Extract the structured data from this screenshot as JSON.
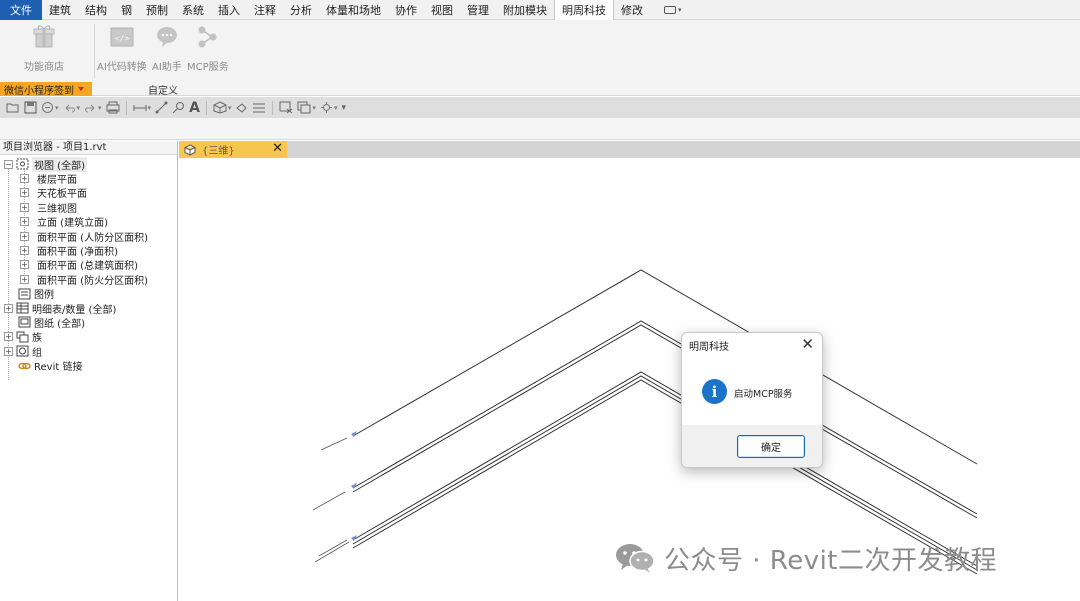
{
  "menu": {
    "tabs": [
      "文件",
      "建筑",
      "结构",
      "钢",
      "预制",
      "系统",
      "插入",
      "注释",
      "分析",
      "体量和场地",
      "协作",
      "视图",
      "管理",
      "附加模块",
      "明周科技",
      "修改"
    ],
    "active_tab": "明周科技"
  },
  "ribbon": {
    "tools": [
      {
        "label": "功能商店",
        "icon": "store-icon"
      },
      {
        "label": "AI代码转换",
        "icon": "code-convert-icon"
      },
      {
        "label": "AI助手",
        "icon": "chat-assistant-icon"
      },
      {
        "label": "MCP服务",
        "icon": "network-nodes-icon"
      }
    ],
    "panels": [
      "微信小程序签到",
      "自定义"
    ]
  },
  "browser": {
    "title": "项目浏览器 - 项目1.rvt",
    "items": [
      {
        "label": "视图 (全部)",
        "level": 0,
        "expander": "⊟",
        "icon": "view-icon"
      },
      {
        "label": "楼层平面",
        "level": 1,
        "expander": "⊞"
      },
      {
        "label": "天花板平面",
        "level": 1,
        "expander": "⊞"
      },
      {
        "label": "三维视图",
        "level": 1,
        "expander": "⊞"
      },
      {
        "label": "立面 (建筑立面)",
        "level": 1,
        "expander": "⊞"
      },
      {
        "label": "面积平面 (人防分区面积)",
        "level": 1,
        "expander": "⊞"
      },
      {
        "label": "面积平面 (净面积)",
        "level": 1,
        "expander": "⊞"
      },
      {
        "label": "面积平面 (总建筑面积)",
        "level": 1,
        "expander": "⊞"
      },
      {
        "label": "面积平面 (防火分区面积)",
        "level": 1,
        "expander": "⊞"
      },
      {
        "label": "图例",
        "level": 0,
        "expander": "",
        "icon": "legend-icon"
      },
      {
        "label": "明细表/数量 (全部)",
        "level": 0,
        "expander": "⊞",
        "icon": "schedule-icon"
      },
      {
        "label": "图纸 (全部)",
        "level": 0,
        "expander": "",
        "icon": "sheet-icon"
      },
      {
        "label": "族",
        "level": 0,
        "expander": "⊞",
        "icon": "family-icon"
      },
      {
        "label": "组",
        "level": 0,
        "expander": "⊞",
        "icon": "group-icon"
      },
      {
        "label": "Revit 链接",
        "level": 0,
        "expander": "",
        "icon": "link-icon"
      }
    ]
  },
  "view_tab": {
    "label": "{三维}",
    "close": "✕"
  },
  "dialog": {
    "title": "明周科技",
    "close": "✕",
    "message": "启动MCP服务",
    "ok_label": "确定"
  },
  "watermark": {
    "text": "公众号 · Revit二次开发教程"
  },
  "colors": {
    "file_tab": "#1e5fb4",
    "panel_highlight": "#f6a623",
    "view_tab": "#f7c64f",
    "info_icon": "#1a73c8"
  }
}
